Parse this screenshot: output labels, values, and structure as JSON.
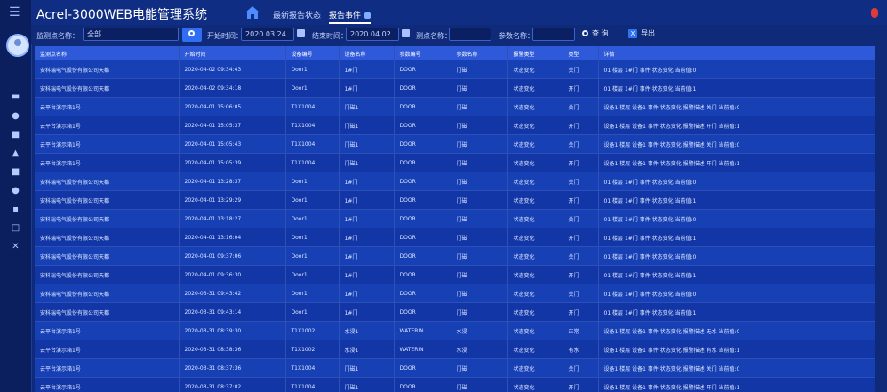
{
  "header": {
    "menu_icon": "menu-icon",
    "title": "Acrel-3000WEB电能管理系统",
    "tabs": [
      {
        "label": "最新报告状态"
      },
      {
        "label": "报告事件"
      }
    ],
    "home_icon": "home-icon",
    "power_icon": "power-icon",
    "accent": "#2f6ef2"
  },
  "filter": {
    "label1": "监测点名称：",
    "value1": "全部",
    "label2": "开始时间：",
    "value2": "2020.03.24",
    "label3": "结束时间：",
    "value3": "2020.04.02",
    "label4": "测点名称：",
    "label5": "参数名称：",
    "query_label": "查 询",
    "export_label": "导出"
  },
  "table": {
    "columns": [
      "监测点名称",
      "开始时间",
      "设备编号",
      "设备名称",
      "参数编号",
      "参数名称",
      "报警类型",
      "类型",
      "详情"
    ],
    "rows": [
      [
        "安科瑞电气股份有限公司天都",
        "2020-04-02 09:34:43",
        "Door1",
        "1#门",
        "DOOR",
        "门磁",
        "状态变化",
        "关门",
        "01 楼层 1#门 事件 状态变化 当前值:0"
      ],
      [
        "安科瑞电气股份有限公司天都",
        "2020-04-02 09:34:18",
        "Door1",
        "1#门",
        "DOOR",
        "门磁",
        "状态变化",
        "开门",
        "01 楼层 1#门 事件 状态变化 当前值:1"
      ],
      [
        "云平台演示箱1号",
        "2020-04-01 15:06:05",
        "T1X1004",
        "门磁1",
        "DOOR",
        "门磁",
        "状态变化",
        "关门",
        "设备1 楼层 设备1 事件 状态变化 报警描述 关门 当前值:0"
      ],
      [
        "云平台演示箱1号",
        "2020-04-01 15:05:37",
        "T1X1004",
        "门磁1",
        "DOOR",
        "门磁",
        "状态变化",
        "开门",
        "设备1 楼层 设备1 事件 状态变化 报警描述 开门 当前值:1"
      ],
      [
        "云平台演示箱1号",
        "2020-04-01 15:05:43",
        "T1X1004",
        "门磁1",
        "DOOR",
        "门磁",
        "状态变化",
        "关门",
        "设备1 楼层 设备1 事件 状态变化 报警描述 关门 当前值:0"
      ],
      [
        "云平台演示箱1号",
        "2020-04-01 15:05:39",
        "T1X1004",
        "门磁1",
        "DOOR",
        "门磁",
        "状态变化",
        "开门",
        "设备1 楼层 设备1 事件 状态变化 报警描述 开门 当前值:1"
      ],
      [
        "安科瑞电气股份有限公司天都",
        "2020-04-01 13:28:37",
        "Door1",
        "1#门",
        "DOOR",
        "门磁",
        "状态变化",
        "关门",
        "01 楼层 1#门 事件 状态变化 当前值:0"
      ],
      [
        "安科瑞电气股份有限公司天都",
        "2020-04-01 13:29:29",
        "Door1",
        "1#门",
        "DOOR",
        "门磁",
        "状态变化",
        "开门",
        "01 楼层 1#门 事件 状态变化 当前值:1"
      ],
      [
        "安科瑞电气股份有限公司天都",
        "2020-04-01 13:18:27",
        "Door1",
        "1#门",
        "DOOR",
        "门磁",
        "状态变化",
        "关门",
        "01 楼层 1#门 事件 状态变化 当前值:0"
      ],
      [
        "安科瑞电气股份有限公司天都",
        "2020-04-01 13:16:04",
        "Door1",
        "1#门",
        "DOOR",
        "门磁",
        "状态变化",
        "开门",
        "01 楼层 1#门 事件 状态变化 当前值:1"
      ],
      [
        "安科瑞电气股份有限公司天都",
        "2020-04-01 09:37:06",
        "Door1",
        "1#门",
        "DOOR",
        "门磁",
        "状态变化",
        "关门",
        "01 楼层 1#门 事件 状态变化 当前值:0"
      ],
      [
        "安科瑞电气股份有限公司天都",
        "2020-04-01 09:36:30",
        "Door1",
        "1#门",
        "DOOR",
        "门磁",
        "状态变化",
        "开门",
        "01 楼层 1#门 事件 状态变化 当前值:1"
      ],
      [
        "安科瑞电气股份有限公司天都",
        "2020-03-31 09:43:42",
        "Door1",
        "1#门",
        "DOOR",
        "门磁",
        "状态变化",
        "关门",
        "01 楼层 1#门 事件 状态变化 当前值:0"
      ],
      [
        "安科瑞电气股份有限公司天都",
        "2020-03-31 09:43:14",
        "Door1",
        "1#门",
        "DOOR",
        "门磁",
        "状态变化",
        "开门",
        "01 楼层 1#门 事件 状态变化 当前值:1"
      ],
      [
        "云平台演示箱1号",
        "2020-03-31 08:39:30",
        "T1X1002",
        "水浸1",
        "WATERIN",
        "水浸",
        "状态变化",
        "正常",
        "设备1 楼层 设备1 事件 状态变化 报警描述 无水 当前值:0"
      ],
      [
        "云平台演示箱1号",
        "2020-03-31 08:38:36",
        "T1X1002",
        "水浸1",
        "WATERIN",
        "水浸",
        "状态变化",
        "有水",
        "设备1 楼层 设备1 事件 状态变化 报警描述 有水 当前值:1"
      ],
      [
        "云平台演示箱1号",
        "2020-03-31 08:37:36",
        "T1X1004",
        "门磁1",
        "DOOR",
        "门磁",
        "状态变化",
        "关门",
        "设备1 楼层 设备1 事件 状态变化 报警描述 关门 当前值:0"
      ],
      [
        "云平台演示箱1号",
        "2020-03-31 08:37:02",
        "T1X1004",
        "门磁1",
        "DOOR",
        "门磁",
        "状态变化",
        "开门",
        "设备1 楼层 设备1 事件 状态变化 报警描述 开门 当前值:1"
      ]
    ]
  }
}
